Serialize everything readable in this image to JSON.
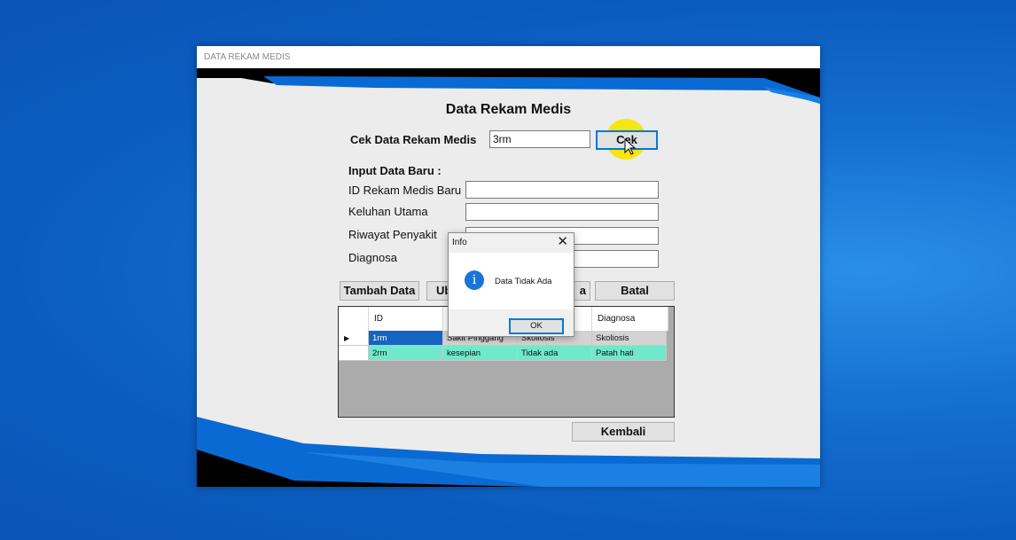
{
  "window": {
    "title": "DATA REKAM MEDIS"
  },
  "form": {
    "heading": "Data Rekam Medis",
    "check_label": "Cek Data Rekam Medis",
    "check_value": "3rm",
    "check_button": "Cek",
    "input_heading": "Input Data Baru :",
    "fields": [
      {
        "label": "ID Rekam Medis Baru",
        "value": ""
      },
      {
        "label": "Keluhan Utama",
        "value": ""
      },
      {
        "label": "Riwayat Penyakit",
        "value": ""
      },
      {
        "label": "Diagnosa",
        "value": ""
      }
    ]
  },
  "buttons": {
    "tambah": "Tambah Data",
    "ubah": "Ub",
    "hapus": "a",
    "batal": "Batal",
    "kembali": "Kembali"
  },
  "table": {
    "columns": [
      "ID",
      "",
      "",
      "Diagnosa"
    ],
    "rows": [
      {
        "id": "1rm",
        "keluhan": "Sakit Pinggang",
        "riwayat": "Skoliosis",
        "diagnosa": "Skoliosis"
      },
      {
        "id": "2rm",
        "keluhan": "kesepian",
        "riwayat": "Tidak ada",
        "diagnosa": "Patah hati"
      }
    ]
  },
  "dialog": {
    "title": "Info",
    "close": "✕",
    "icon": "i",
    "message": "Data Tidak Ada",
    "ok": "OK"
  },
  "colors": {
    "accent": "#0078d7",
    "selected_cell": "#1565c0",
    "row_highlight": "#6fe8cc",
    "row_selected": "#d3d3d3"
  }
}
